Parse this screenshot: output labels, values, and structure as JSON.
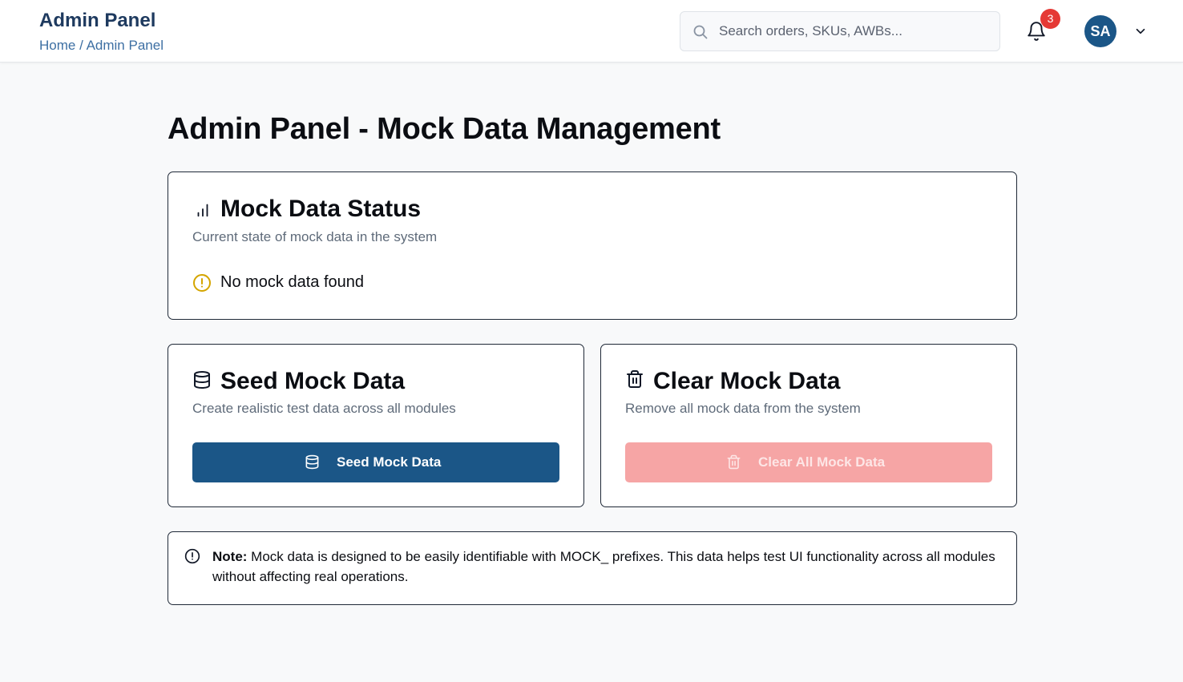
{
  "header": {
    "title": "Admin Panel",
    "breadcrumb": "Home / Admin Panel",
    "search_placeholder": "Search orders, SKUs, AWBs...",
    "notification_count": "3",
    "avatar_initials": "SA"
  },
  "main": {
    "page_title": "Admin Panel - Mock Data Management",
    "status_card": {
      "title": "Mock Data Status",
      "subtitle": "Current state of mock data in the system",
      "status_message": "No mock data found",
      "icon": "bar-chart-icon"
    },
    "seed_card": {
      "title": "Seed Mock Data",
      "subtitle": "Create realistic test data across all modules",
      "button_label": "Seed Mock Data",
      "icon": "database-icon"
    },
    "clear_card": {
      "title": "Clear Mock Data",
      "subtitle": "Remove all mock data from the system",
      "button_label": "Clear All Mock Data",
      "icon": "trash-icon"
    },
    "note": {
      "label": "Note:",
      "text": " Mock data is designed to be easily identifiable with MOCK_ prefixes. This data helps test UI functionality across all modules without affecting real operations."
    }
  },
  "colors": {
    "primary": "#1b5687",
    "danger_disabled": "#f6a5a5",
    "warning": "#d4a500",
    "badge": "#e53935"
  }
}
